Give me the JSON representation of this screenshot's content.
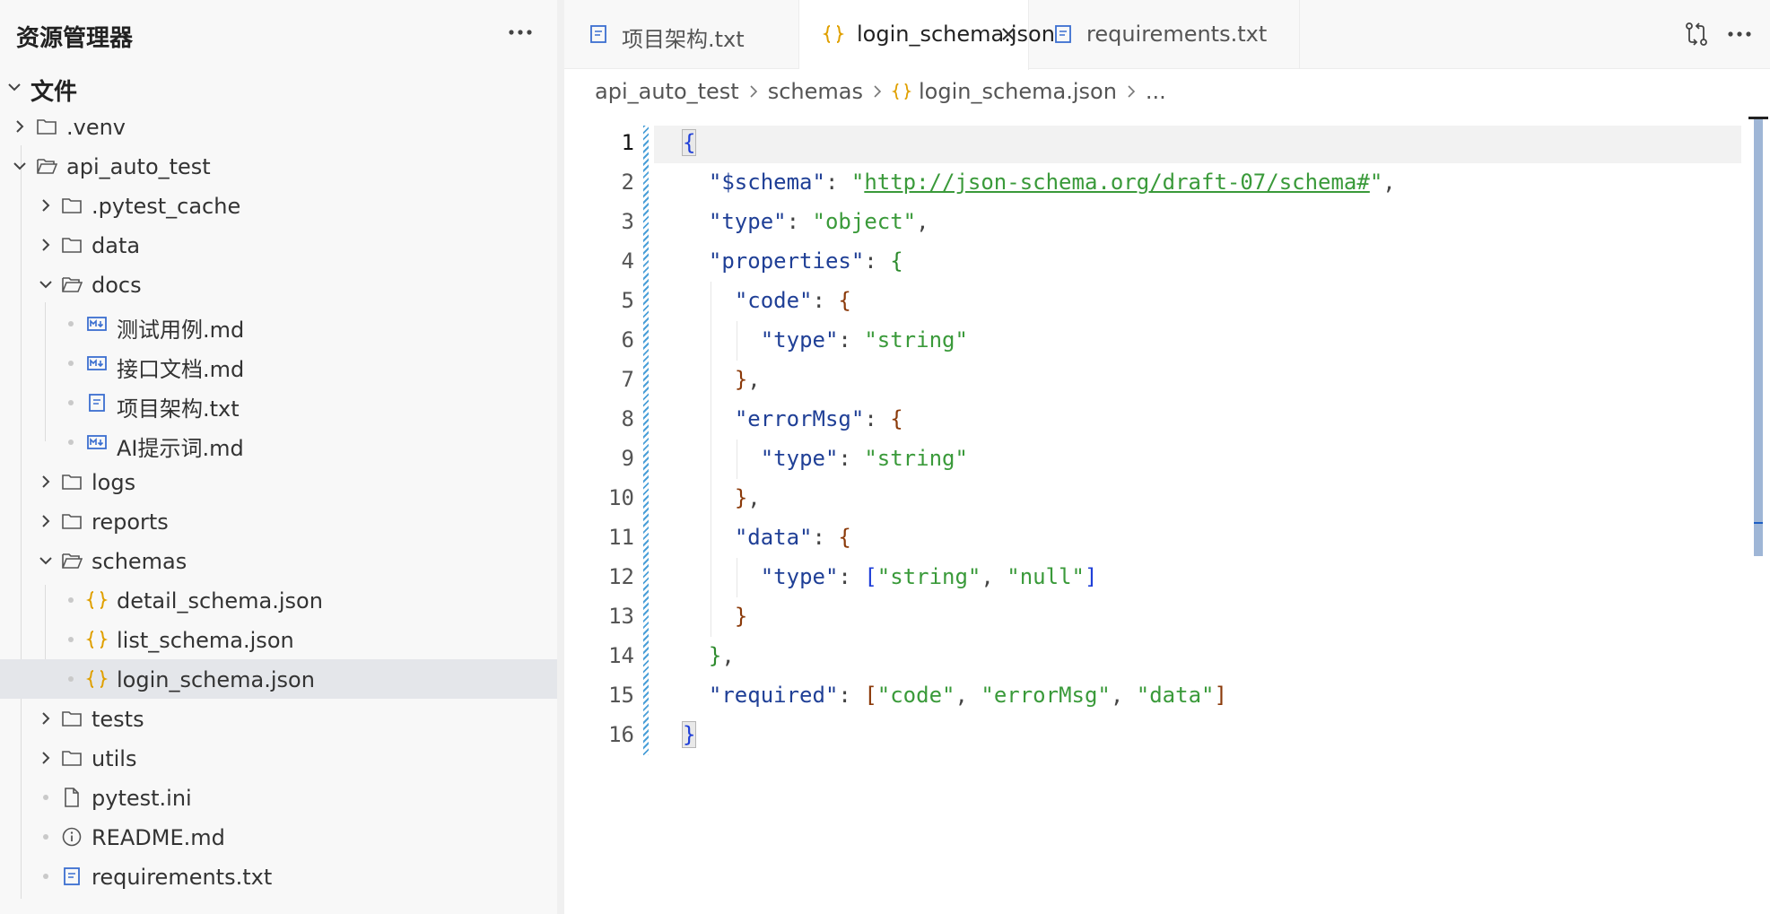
{
  "explorer": {
    "title": "资源管理器",
    "more_icon": "ellipsis-icon",
    "root_label": "文件",
    "items": [
      {
        "label": ".venv",
        "kind": "folder",
        "expanded": false
      },
      {
        "label": "api_auto_test",
        "kind": "folder",
        "expanded": true
      },
      {
        "label": ".pytest_cache",
        "kind": "folder",
        "expanded": false
      },
      {
        "label": "data",
        "kind": "folder",
        "expanded": false
      },
      {
        "label": "docs",
        "kind": "folder",
        "expanded": true
      },
      {
        "label": "测试用例.md",
        "kind": "markdown"
      },
      {
        "label": "接口文档.md",
        "kind": "markdown"
      },
      {
        "label": "项目架构.txt",
        "kind": "text"
      },
      {
        "label": "AI提示词.md",
        "kind": "markdown"
      },
      {
        "label": "logs",
        "kind": "folder",
        "expanded": false
      },
      {
        "label": "reports",
        "kind": "folder",
        "expanded": false
      },
      {
        "label": "schemas",
        "kind": "folder",
        "expanded": true
      },
      {
        "label": "detail_schema.json",
        "kind": "json"
      },
      {
        "label": "list_schema.json",
        "kind": "json"
      },
      {
        "label": "login_schema.json",
        "kind": "json",
        "selected": true
      },
      {
        "label": "tests",
        "kind": "folder",
        "expanded": false
      },
      {
        "label": "utils",
        "kind": "folder",
        "expanded": false
      },
      {
        "label": "pytest.ini",
        "kind": "file"
      },
      {
        "label": "README.md",
        "kind": "info"
      },
      {
        "label": "requirements.txt",
        "kind": "text"
      }
    ]
  },
  "tabs": [
    {
      "label": "项目架构.txt",
      "icon": "text-file-icon",
      "active": false
    },
    {
      "label": "login_schema.json",
      "icon": "json-file-icon",
      "active": true
    },
    {
      "label": "requirements.txt",
      "icon": "text-file-icon",
      "active": false
    }
  ],
  "toolbar": {
    "compare_icon": "compare-changes-icon",
    "more_icon": "ellipsis-icon"
  },
  "breadcrumb": [
    "api_auto_test",
    "schemas",
    "login_schema.json",
    "..."
  ],
  "editor": {
    "current_line": 1,
    "line_numbers": [
      "1",
      "2",
      "3",
      "4",
      "5",
      "6",
      "7",
      "8",
      "9",
      "10",
      "11",
      "12",
      "13",
      "14",
      "15",
      "16"
    ],
    "lines": [
      "{",
      "  \"$schema\": \"http://json-schema.org/draft-07/schema#\",",
      "  \"type\": \"object\",",
      "  \"properties\": {",
      "    \"code\": {",
      "      \"type\": \"string\"",
      "    },",
      "    \"errorMsg\": {",
      "      \"type\": \"string\"",
      "    },",
      "    \"data\": {",
      "      \"type\": [\"string\", \"null\"]",
      "    }",
      "  },",
      "  \"required\": [\"code\", \"errorMsg\", \"data\"]",
      "}"
    ]
  },
  "colors": {
    "key": "#1f3f96",
    "string": "#3a9a3a",
    "bracket_level1": "#1f3fd8",
    "bracket_level2": "#2e8b2e",
    "bracket_level3": "#8b3a0a",
    "selected_row": "#e4e6ea",
    "json_icon": "#e0a000",
    "md_icon": "#3b6fd0"
  }
}
